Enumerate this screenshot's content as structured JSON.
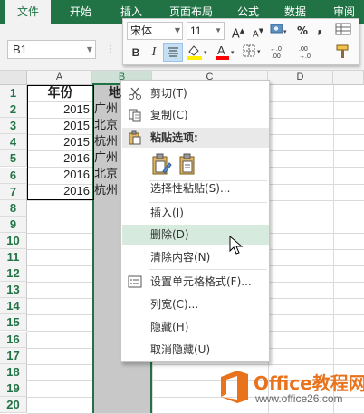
{
  "ribbon": {
    "tabs": [
      {
        "label": "文件",
        "active": true
      },
      {
        "label": "开始"
      },
      {
        "label": "插入"
      },
      {
        "label": "页面布局"
      },
      {
        "label": "公式"
      },
      {
        "label": "数据"
      },
      {
        "label": "审阅"
      }
    ]
  },
  "name_box": {
    "value": "B1"
  },
  "mini_toolbar": {
    "font_name": "宋体",
    "font_size": "11",
    "bold": "B",
    "italic": "I",
    "percent": "%",
    "comma": ",",
    "increase_decimal": ".0→.00",
    "decrease_decimal": ".00→.0",
    "font_color": "A",
    "highlight_color": "#ffef00",
    "font_color_value": "#ff0000"
  },
  "columns": [
    "A",
    "B",
    "C",
    "D"
  ],
  "rows": [
    "1",
    "2",
    "3",
    "4",
    "5",
    "6",
    "7",
    "8",
    "9",
    "10",
    "11",
    "12",
    "13",
    "14",
    "15",
    "16",
    "17",
    "18",
    "19",
    "20"
  ],
  "table": {
    "headers": {
      "year": "年份",
      "region": "地"
    },
    "years": [
      "2015",
      "2015",
      "2015",
      "2016",
      "2016",
      "2016"
    ],
    "regions": [
      "广州",
      "北京",
      "杭州",
      "广州",
      "北京",
      "杭州"
    ]
  },
  "context_menu": {
    "items": [
      {
        "label": "剪切(T)",
        "icon": "scissors-icon"
      },
      {
        "label": "复制(C)",
        "icon": "copy-icon"
      },
      {
        "label": "粘贴选项:",
        "icon": "paste-icon",
        "section": true
      },
      {
        "label": "",
        "icon": "paste-option-icons"
      },
      {
        "label": "选择性粘贴(S)..."
      },
      {
        "label": "插入(I)"
      },
      {
        "label": "删除(D)",
        "hover": true
      },
      {
        "label": "清除内容(N)"
      },
      {
        "label": "设置单元格格式(F)...",
        "icon": "format-cells-icon"
      },
      {
        "label": "列宽(C)..."
      },
      {
        "label": "隐藏(H)"
      },
      {
        "label": "取消隐藏(U)"
      }
    ]
  },
  "watermark": {
    "title": "Office教程网",
    "url": "www.office26.com"
  },
  "colors": {
    "excel_green": "#217346",
    "selection_gray": "#c8c8c8",
    "hover_green": "#d6ebde",
    "watermark_orange": "#e8731c"
  }
}
